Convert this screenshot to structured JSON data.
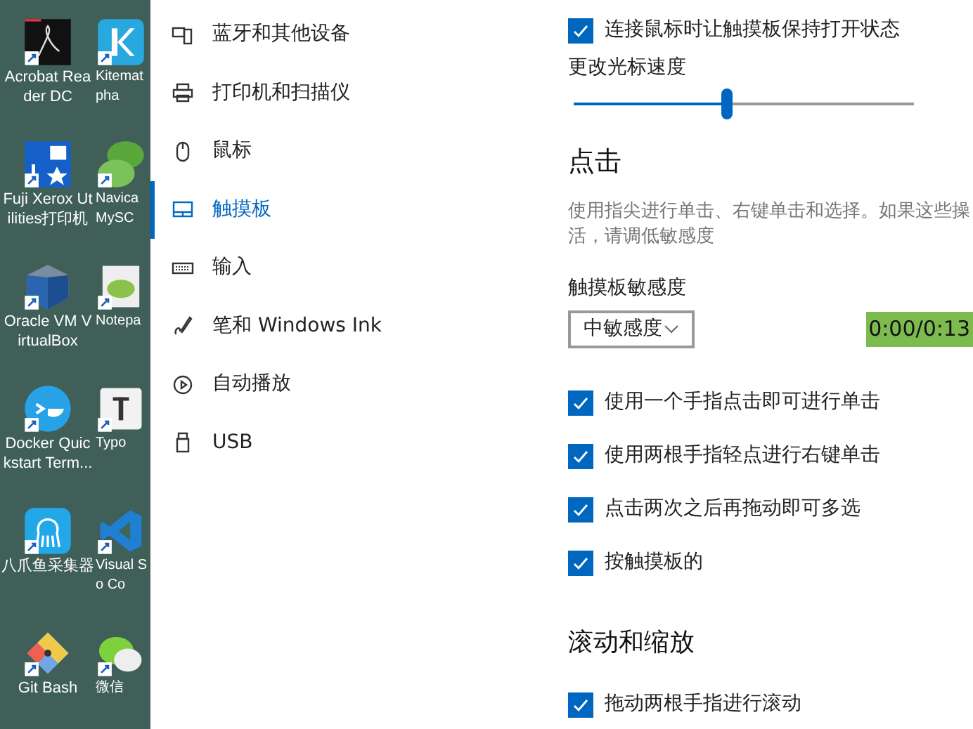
{
  "desktop_icons": [
    {
      "lines": [
        "Acrobat Rea",
        "der DC"
      ],
      "kind": "acrobat"
    },
    {
      "lines": [
        "Kitemat",
        "pha"
      ],
      "kind": "kitematic"
    },
    {
      "lines": [
        "Fuji Xerox Ut",
        "ilities打印机"
      ],
      "kind": "fuji"
    },
    {
      "lines": [
        "Navica",
        "MySC"
      ],
      "kind": "navicat"
    },
    {
      "lines": [
        "Oracle VM V",
        "irtualBox"
      ],
      "kind": "virtualbox"
    },
    {
      "lines": [
        "Notepa"
      ],
      "kind": "notepad"
    },
    {
      "lines": [
        "Docker Quic",
        "kstart Term..."
      ],
      "kind": "docker"
    },
    {
      "lines": [
        "Typo"
      ],
      "kind": "typora"
    },
    {
      "lines": [
        "八爪鱼采集器"
      ],
      "kind": "octopus"
    },
    {
      "lines": [
        "Visual S",
        "o Co"
      ],
      "kind": "vscode"
    },
    {
      "lines": [
        "Git Bash"
      ],
      "kind": "git"
    },
    {
      "lines": [
        "微信"
      ],
      "kind": "wechat"
    }
  ],
  "nav": [
    {
      "label": "蓝牙和其他设备",
      "kind": "bluetooth",
      "selected": false
    },
    {
      "label": "打印机和扫描仪",
      "kind": "printer",
      "selected": false
    },
    {
      "label": "鼠标",
      "kind": "mouse",
      "selected": false
    },
    {
      "label": "触摸板",
      "kind": "touchpad",
      "selected": true
    },
    {
      "label": "输入",
      "kind": "keyboard",
      "selected": false
    },
    {
      "label": "笔和 Windows Ink",
      "kind": "pen",
      "selected": false
    },
    {
      "label": "自动播放",
      "kind": "autoplay",
      "selected": false
    },
    {
      "label": "USB",
      "kind": "usb",
      "selected": false
    }
  ],
  "keep_on": {
    "label": "连接鼠标时让触摸板保持打开状态",
    "checked": true
  },
  "cursor_speed": {
    "label": "更改光标速度",
    "level": 0.45
  },
  "taps": {
    "heading": "点击",
    "description": [
      "使用指尖进行单击、右键单击和选择。如果这些操",
      "活，请调低敏感度"
    ],
    "sensitivity_label": "触摸板敏感度",
    "sensitivity_value": "中敏感度",
    "options": [
      {
        "label": "使用一个手指点击即可进行单击",
        "checked": true
      },
      {
        "label": "使用两根手指轻点进行右键单击",
        "checked": true
      },
      {
        "label": "点击两次之后再拖动即可多选",
        "checked": true
      },
      {
        "label": "按触摸板的",
        "checked": true
      }
    ]
  },
  "video_time": "0:00/0:13",
  "scroll_zoom": {
    "heading": "滚动和缩放",
    "options": [
      {
        "label": "拖动两根手指进行滚动",
        "checked": true
      }
    ]
  }
}
